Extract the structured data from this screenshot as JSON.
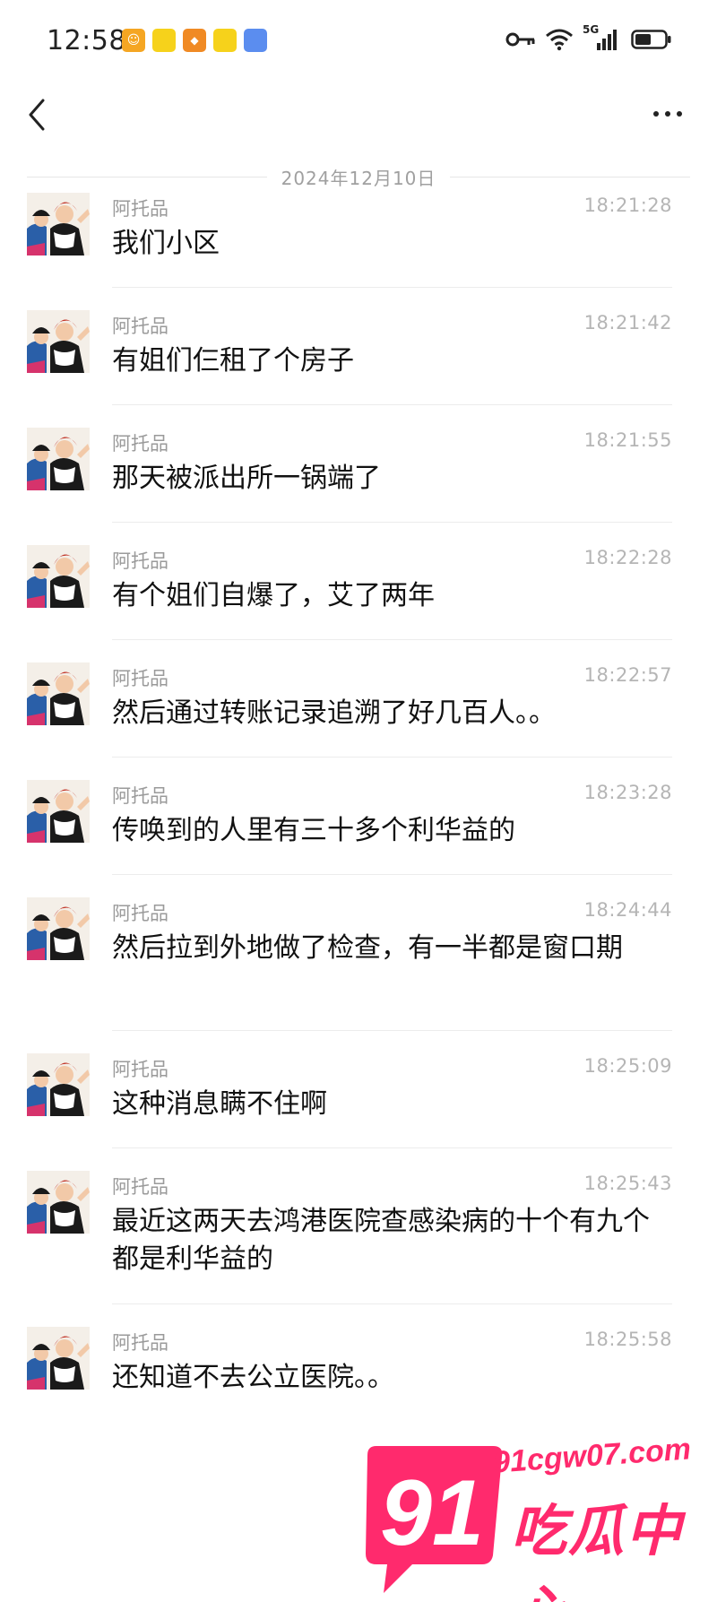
{
  "status_bar": {
    "time": "12:58",
    "network": "5G",
    "notification_icons": [
      "orange-app-icon",
      "meituan-icon",
      "game-app-icon",
      "meituan-icon",
      "blue-app-icon"
    ]
  },
  "nav": {
    "back_icon": "chevron-left-icon",
    "more_icon": "more-dots-icon"
  },
  "date_divider": "2024年12月10日",
  "messages": [
    {
      "sender": "阿托品",
      "time": "18:21:28",
      "text": "我们小区"
    },
    {
      "sender": "阿托品",
      "time": "18:21:42",
      "text": "有姐们仨租了个房子"
    },
    {
      "sender": "阿托品",
      "time": "18:21:55",
      "text": "那天被派出所一锅端了"
    },
    {
      "sender": "阿托品",
      "time": "18:22:28",
      "text": "有个姐们自爆了，艾了两年"
    },
    {
      "sender": "阿托品",
      "time": "18:22:57",
      "text": "然后通过转账记录追溯了好几百人。。"
    },
    {
      "sender": "阿托品",
      "time": "18:23:28",
      "text": "传唤到的人里有三十多个利华益的"
    },
    {
      "sender": "阿托品",
      "time": "18:24:44",
      "text": "然后拉到外地做了检查，有一半都是窗口期"
    },
    {
      "sender": "阿托品",
      "time": "18:25:09",
      "text": "这种消息瞒不住啊"
    },
    {
      "sender": "阿托品",
      "time": "18:25:43",
      "text": "最近这两天去鸿港医院查感染病的十个有九个都是利华益的"
    },
    {
      "sender": "阿托品",
      "time": "18:25:58",
      "text": "还知道不去公立医院。。"
    }
  ],
  "watermark": {
    "logo_number": "91",
    "url": "91cgw07.com",
    "name": "吃瓜中心"
  },
  "colors": {
    "background": "#ffffff",
    "text": "#111111",
    "meta": "#9a9a9a",
    "watermark": "#ff2a6d"
  }
}
